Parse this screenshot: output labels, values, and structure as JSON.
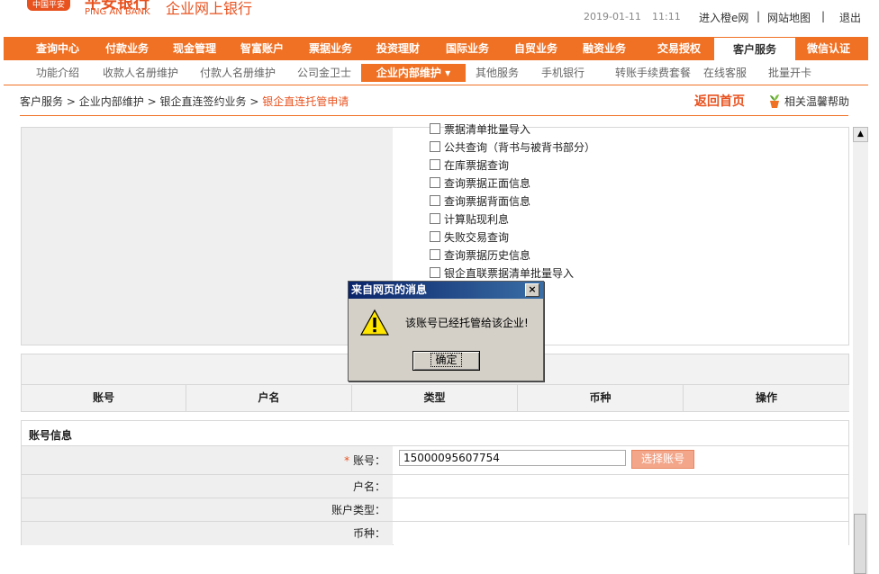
{
  "header": {
    "logo_badge": "中国平安",
    "bank_name_cn": "平安银行",
    "bank_name_en": "PING AN BANK",
    "system_title": "企业网上银行",
    "date": "2019-01-11",
    "time": "11:11",
    "links": [
      "进入橙e网",
      "网站地图",
      "退出"
    ]
  },
  "main_nav": {
    "tabs": [
      "查询中心",
      "付款业务",
      "现金管理",
      "智富账户",
      "票据业务",
      "投资理财",
      "国际业务",
      "自贸业务",
      "融资业务",
      "交易授权",
      "客户服务",
      "微信认证"
    ],
    "active": "客户服务"
  },
  "sub_nav": {
    "tabs": [
      "功能介绍",
      "收款人名册维护",
      "付款人名册维护",
      "公司金卫士",
      "企业内部维护 ▾",
      "其他服务",
      "手机银行",
      "转账手续费套餐",
      "在线客服",
      "批量开卡"
    ],
    "active": "企业内部维护 ▾"
  },
  "breadcrumb": {
    "items": [
      "客户服务",
      "企业内部维护",
      "银企直连签约业务"
    ],
    "separator": ">",
    "current": "银企直连托管申请",
    "back_home": "返回首页",
    "help": "相关温馨帮助"
  },
  "permissions": [
    "票据清单批量导入",
    "公共查询（背书与被背书部分）",
    "在库票据查询",
    "查询票据正面信息",
    "查询票据背面信息",
    "计算贴现利息",
    "失败交易查询",
    "查询票据历史信息",
    "银企直联票据清单批量导入"
  ],
  "accounts_table": {
    "columns": [
      "账号",
      "户名",
      "类型",
      "币种",
      "操作"
    ]
  },
  "account_info": {
    "title": "账号信息",
    "required_mark": "*",
    "fields": [
      {
        "label": "账号：",
        "value": "15000095607754"
      },
      {
        "label": "户名：",
        "value": ""
      },
      {
        "label": "账户类型：",
        "value": ""
      },
      {
        "label": "币种：",
        "value": ""
      }
    ],
    "choose_button": "选择账号"
  },
  "dialog": {
    "title": "来自网页的消息",
    "message": "该账号已经托管给该企业!",
    "ok": "确定",
    "close": "×"
  },
  "colors": {
    "brand_orange": "#f07124",
    "dialog_title": "#0a246a"
  }
}
